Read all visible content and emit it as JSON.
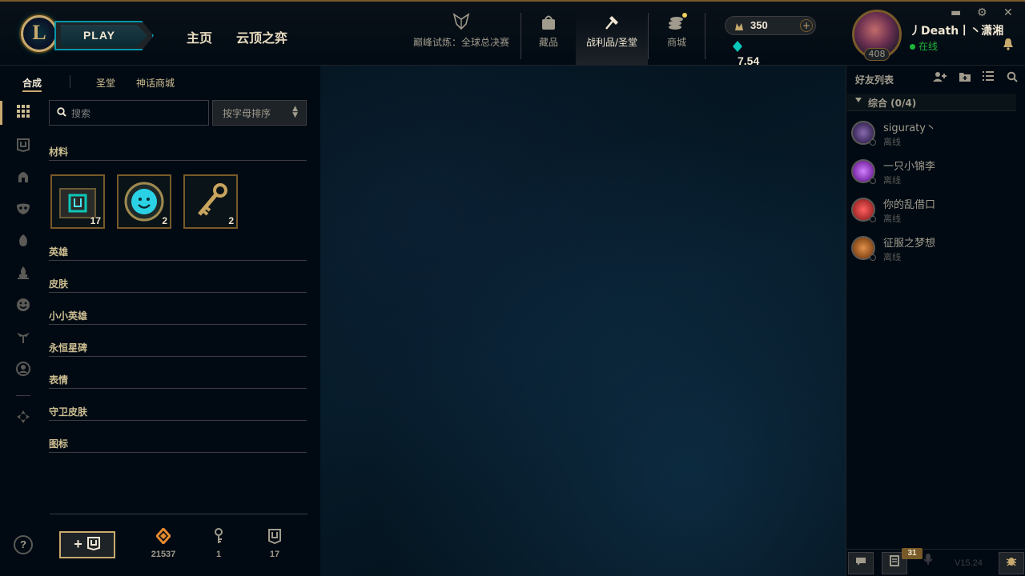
{
  "topbar": {
    "play_label": "PLAY",
    "nav_main": [
      "主页",
      "云顶之弈"
    ],
    "nav_items": [
      {
        "label": "巅峰试炼：全球总决赛",
        "icon": "worlds-trophy-icon"
      },
      {
        "label": "藏品",
        "icon": "collection-bag-icon"
      },
      {
        "label": "战利品/圣堂",
        "icon": "loot-hammer-icon"
      },
      {
        "label": "商城",
        "icon": "store-coins-icon"
      }
    ],
    "rp_value": "350",
    "rp_plus": "+",
    "be_value": "7.54万"
  },
  "profile": {
    "name": "丿Death丨丶潇湘",
    "status": "在线",
    "level": "408"
  },
  "window_controls": {
    "minimize": "▬",
    "settings": "⚙",
    "close": "✕"
  },
  "left": {
    "subtabs": [
      "合成",
      "圣堂",
      "神话商城"
    ],
    "search_placeholder": "搜索",
    "sort_value": "按字母排序",
    "categories": [
      "材料",
      "英雄",
      "皮肤",
      "小小英雄",
      "永恒星碑",
      "表情",
      "守卫皮肤",
      "图标"
    ],
    "materials": [
      {
        "icon": "hextech-chest-icon",
        "count": "17"
      },
      {
        "icon": "emote-orb-icon",
        "count": "2"
      },
      {
        "icon": "hextech-key-icon",
        "count": "2"
      }
    ],
    "help_label": "?",
    "craft_label": "+",
    "resources": [
      {
        "icon": "orange-essence-icon",
        "value": "21537"
      },
      {
        "icon": "key-fragment-icon",
        "value": "1"
      },
      {
        "icon": "chest-icon",
        "value": "17"
      }
    ]
  },
  "friends": {
    "title": "好友列表",
    "group": "综合 (0/4)",
    "list": [
      {
        "name": "siguraty丶",
        "status": "离线",
        "avatar_color": "#3a2a5a"
      },
      {
        "name": "一只小锦李",
        "status": "离线",
        "avatar_color": "#7a2aa5"
      },
      {
        "name": "你的乱借口",
        "status": "离线",
        "avatar_color": "#a52a2a"
      },
      {
        "name": "征服之梦想",
        "status": "离线",
        "avatar_color": "#8a4a1a"
      }
    ],
    "badge_count": "31",
    "version": "V15.24"
  },
  "colors": {
    "gold": "#c8aa6e",
    "teal": "#0397ab",
    "online": "#1eb53a"
  }
}
